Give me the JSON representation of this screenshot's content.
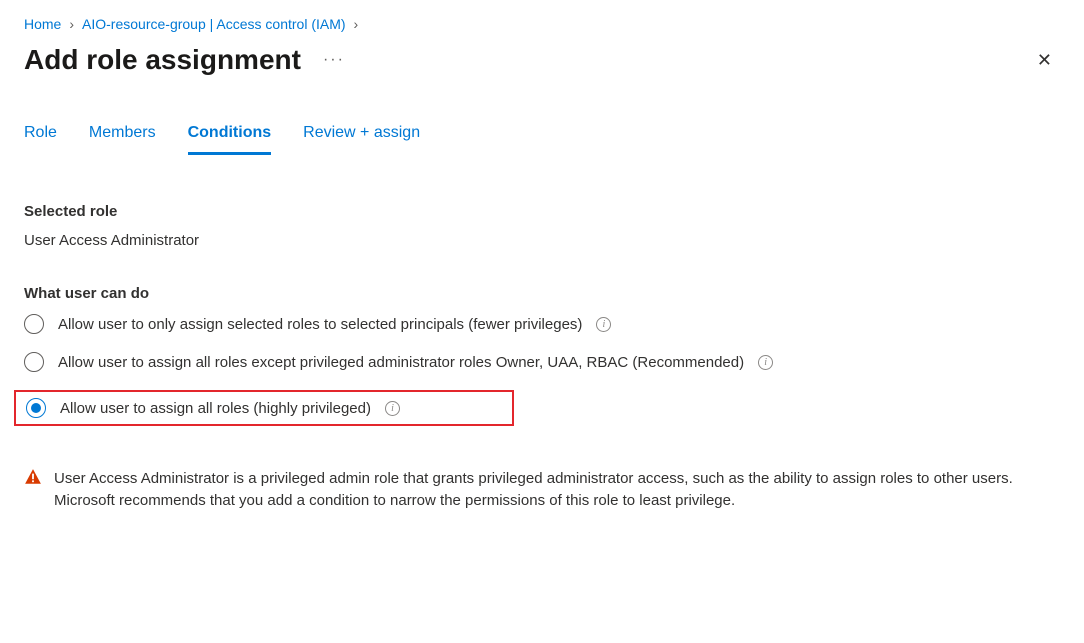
{
  "breadcrumb": {
    "home": "Home",
    "resource": "AIO-resource-group | Access control (IAM)"
  },
  "page_title": "Add role assignment",
  "tabs": {
    "role": "Role",
    "members": "Members",
    "conditions": "Conditions",
    "review": "Review + assign"
  },
  "selected_role_label": "Selected role",
  "selected_role_value": "User Access Administrator",
  "what_user_can_do_label": "What user can do",
  "options": {
    "opt1": "Allow user to only assign selected roles to selected principals (fewer privileges)",
    "opt2": "Allow user to assign all roles except privileged administrator roles Owner, UAA, RBAC (Recommended)",
    "opt3": "Allow user to assign all roles (highly privileged)"
  },
  "warning_text": "User Access Administrator is a privileged admin role that grants privileged administrator access, such as the ability to assign roles to other users. Microsoft recommends that you add a condition to narrow the permissions of this role to least privilege."
}
